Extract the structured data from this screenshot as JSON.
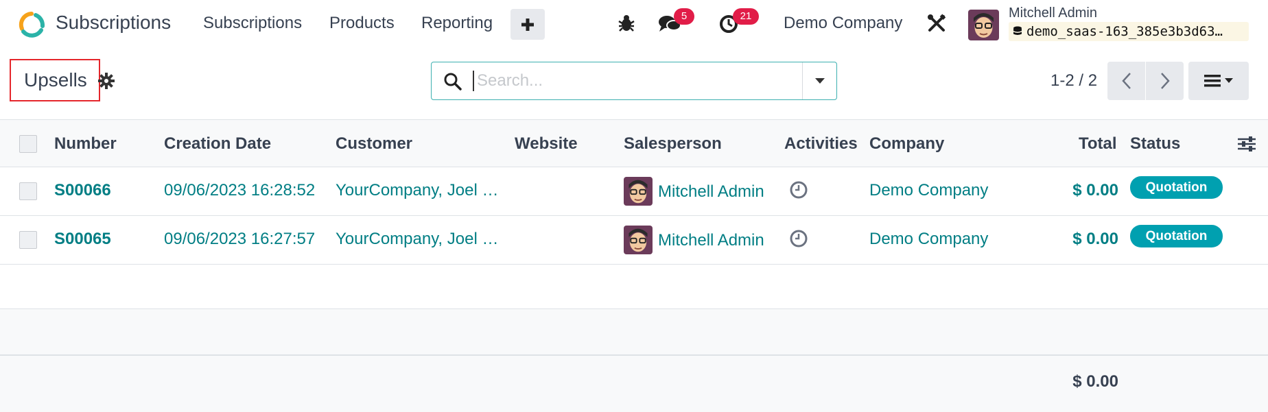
{
  "navbar": {
    "app_name": "Subscriptions",
    "menu": [
      "Subscriptions",
      "Products",
      "Reporting"
    ],
    "plus_label": "+",
    "messages_badge": "5",
    "activities_badge": "21",
    "company": "Demo Company",
    "user_name": "Mitchell Admin",
    "database": "demo_saas-163_385e3b3d63…",
    "icons": [
      "bug-icon",
      "chat-icon",
      "clock-icon",
      "tools-icon"
    ]
  },
  "control": {
    "title": "Upsells",
    "search_placeholder": "Search...",
    "pager": "1-2 / 2"
  },
  "table": {
    "headers": [
      "Number",
      "Creation Date",
      "Customer",
      "Website",
      "Salesperson",
      "Activities",
      "Company",
      "Total",
      "Status"
    ],
    "rows": [
      {
        "number": "S00066",
        "date": "09/06/2023 16:28:52",
        "customer": "YourCompany, Joel …",
        "website": "",
        "salesperson": "Mitchell Admin",
        "company": "Demo Company",
        "total": "$ 0.00",
        "status": "Quotation"
      },
      {
        "number": "S00065",
        "date": "09/06/2023 16:27:57",
        "customer": "YourCompany, Joel …",
        "website": "",
        "salesperson": "Mitchell Admin",
        "company": "Demo Company",
        "total": "$ 0.00",
        "status": "Quotation"
      }
    ],
    "footer_total": "$ 0.00"
  },
  "colors": {
    "accent": "#017e84",
    "status_badge": "#00a0b0",
    "notification": "#e11d48",
    "highlight_box": "#e5262b"
  }
}
